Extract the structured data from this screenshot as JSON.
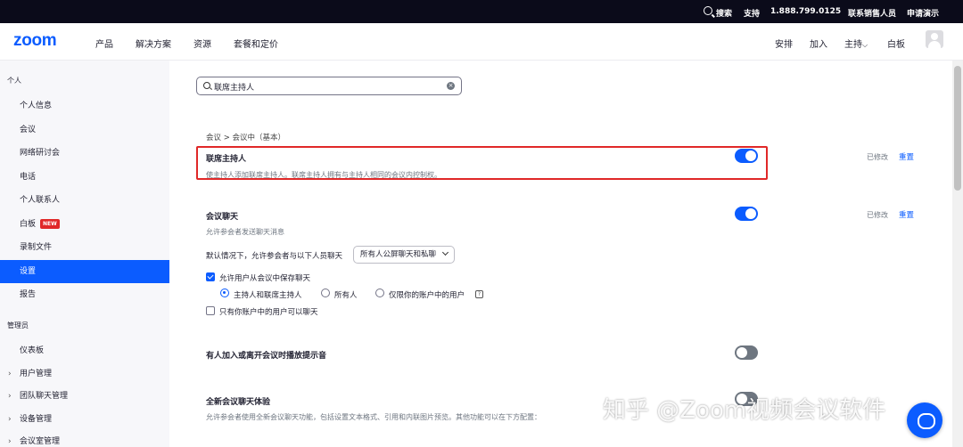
{
  "topbar": {
    "search": "搜索",
    "support": "支持",
    "phone": "1.888.799.0125",
    "contact_sales": "联系销售人员",
    "request_demo": "申请演示"
  },
  "nav": {
    "logo": "zoom",
    "left": [
      "产品",
      "解决方案",
      "资源",
      "套餐和定价"
    ],
    "right": {
      "schedule": "安排",
      "join": "加入",
      "host": "主持",
      "whiteboard": "白板"
    }
  },
  "sidebar": {
    "personal_header": "个人",
    "personal_items": [
      "个人信息",
      "会议",
      "网络研讨会",
      "电话",
      "个人联系人",
      "白板",
      "录制文件",
      "设置",
      "报告"
    ],
    "new_badge": "NEW",
    "active_item": "设置",
    "admin_header": "管理员",
    "admin_items": [
      "仪表板",
      "用户管理",
      "团队聊天管理",
      "设备管理",
      "会议室管理"
    ]
  },
  "search": {
    "value": "联席主持人"
  },
  "breadcrumb": "会议 > 会议中（基本）",
  "settings": {
    "cohost": {
      "title": "联席主持人",
      "desc": "使主持人添加联席主持人。联席主持人拥有与主持人相同的会议内控制权。",
      "enabled": true,
      "modified": "已修改",
      "reset": "重置"
    },
    "chat": {
      "title": "会议聊天",
      "desc": "允许参会者发送聊天消息",
      "enabled": true,
      "modified": "已修改",
      "reset": "重置",
      "default_label": "默认情况下，允许参会者与以下人员聊天",
      "default_value": "所有人公屏聊天和私聊",
      "save_chat_label": "允许用户从会议中保存聊天",
      "save_chat_checked": true,
      "radio_options": [
        "主持人和联席主持人",
        "所有人",
        "仅限你的账户中的用户"
      ],
      "radio_selected": 0,
      "only_account_label": "只有你账户中的用户可以聊天",
      "only_account_checked": false
    },
    "join_sound": {
      "title": "有人加入或离开会议时播放提示音",
      "enabled": false
    },
    "new_chat": {
      "title": "全新会议聊天体验",
      "desc": "允许参会者使用全新会议聊天功能，包括设置文本格式、引用和内联图片预览。其他功能可以在下方配置：",
      "enabled": false
    }
  },
  "watermark": "知乎 @Zoom视频会议软件",
  "colors": {
    "accent": "#0b5cff",
    "highlight_border": "#e02828",
    "topbar": "#0b0b1a"
  }
}
